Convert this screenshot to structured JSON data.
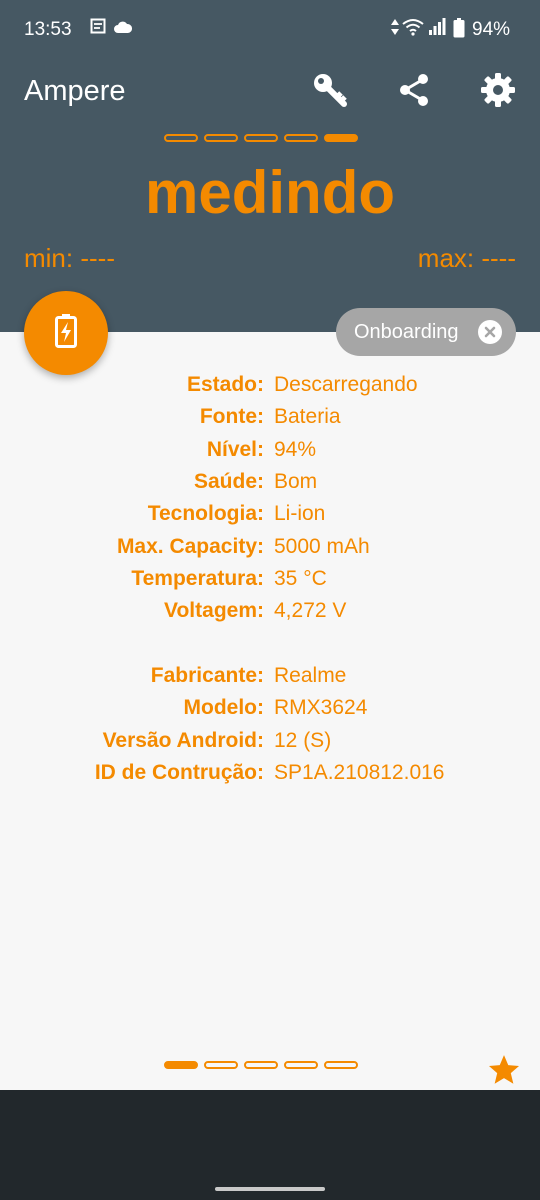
{
  "status_bar": {
    "time": "13:53",
    "battery_percent": "94%",
    "icons": [
      "notes-icon",
      "cloud-icon",
      "data-arrows-icon",
      "wifi-icon",
      "signal-icon",
      "battery-icon"
    ]
  },
  "app_bar": {
    "title": "Ampere",
    "actions": [
      "key-icon",
      "share-icon",
      "settings-icon"
    ]
  },
  "measurement": {
    "state": "medindo",
    "min_label": "min: ----",
    "max_label": "max: ----",
    "top_pager_active_index": 4,
    "top_pager_count": 5
  },
  "onboarding_chip": {
    "label": "Onboarding"
  },
  "info": {
    "battery": [
      {
        "key": "Estado:",
        "value": "Descarregando"
      },
      {
        "key": "Fonte:",
        "value": "Bateria"
      },
      {
        "key": "Nível:",
        "value": "94%"
      },
      {
        "key": "Saúde:",
        "value": "Bom"
      },
      {
        "key": "Tecnologia:",
        "value": "Li-ion"
      },
      {
        "key": "Max. Capacity:",
        "value": "5000 mAh"
      },
      {
        "key": "Temperatura:",
        "value": "35 °C"
      },
      {
        "key": "Voltagem:",
        "value": "4,272 V"
      }
    ],
    "device": [
      {
        "key": "Fabricante:",
        "value": "Realme"
      },
      {
        "key": "Modelo:",
        "value": "RMX3624"
      },
      {
        "key": "Versão Android:",
        "value": "12 (S)"
      },
      {
        "key": "ID de Contrução:",
        "value": "SP1A.210812.016"
      }
    ]
  },
  "bottom_pager": {
    "active_index": 0,
    "count": 5
  },
  "colors": {
    "accent": "#f48a00",
    "header": "#465863",
    "chip": "#a6a6a6",
    "nav_bar": "#22282c"
  }
}
